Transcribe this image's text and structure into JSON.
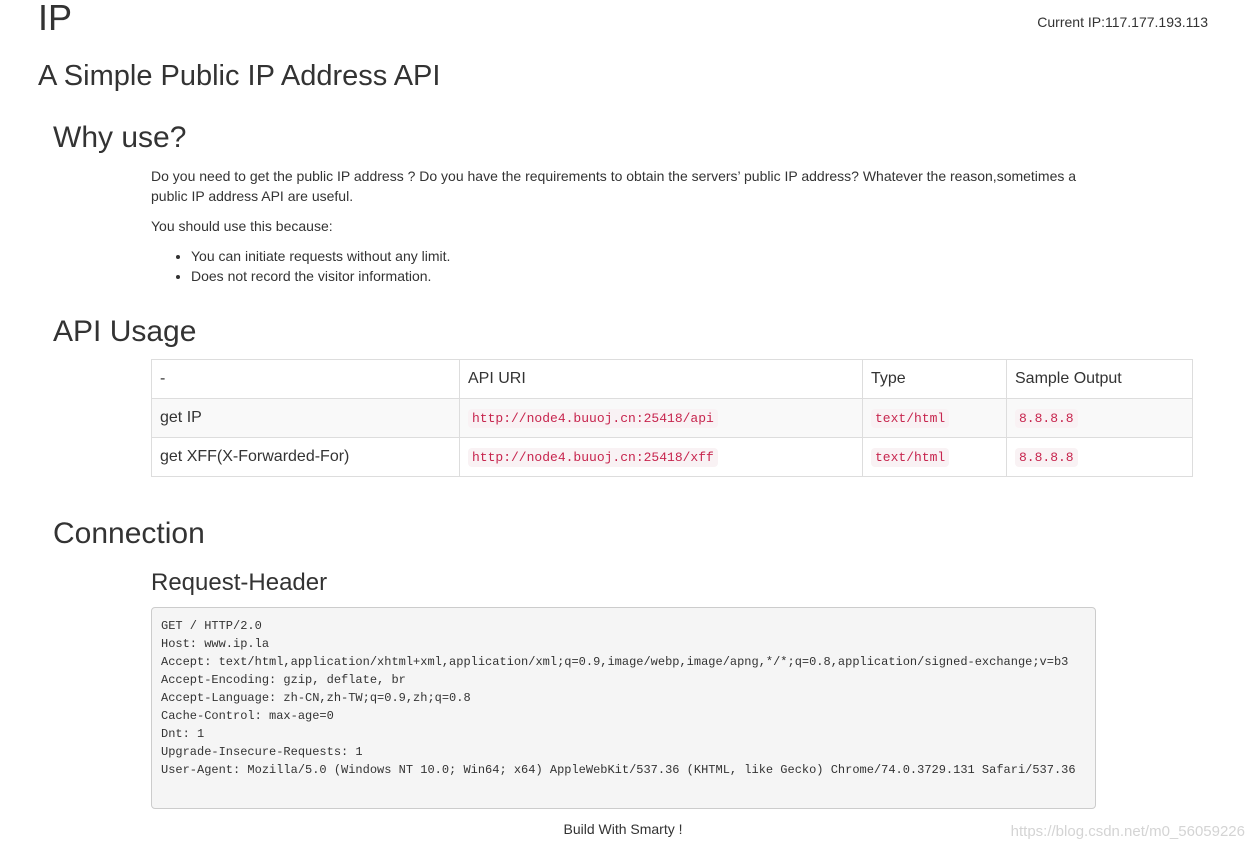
{
  "header": {
    "site_title": "IP",
    "current_ip": "Current IP:117.177.193.113",
    "subtitle": "A Simple Public IP Address API"
  },
  "why": {
    "title": "Why use?",
    "paragraph1": "Do you need to get the public IP address ? Do you have the requirements to obtain the servers’ public IP address? Whatever the reason,sometimes a public IP address API are useful.",
    "paragraph2": "You should use this because:",
    "bullets": [
      "You can initiate requests without any limit.",
      "Does not record the visitor information."
    ]
  },
  "api": {
    "title": "API Usage",
    "headers": [
      "-",
      "API URI",
      "Type",
      "Sample Output"
    ],
    "rows": [
      {
        "name": "get IP",
        "uri": "http://node4.buuoj.cn:25418/api",
        "type": "text/html",
        "output": "8.8.8.8"
      },
      {
        "name": "get XFF(X-Forwarded-For)",
        "uri": "http://node4.buuoj.cn:25418/xff",
        "type": "text/html",
        "output": "8.8.8.8"
      }
    ]
  },
  "connection": {
    "title": "Connection",
    "request_header_title": "Request-Header",
    "request_header": "GET / HTTP/2.0\nHost: www.ip.la\nAccept: text/html,application/xhtml+xml,application/xml;q=0.9,image/webp,image/apng,*/*;q=0.8,application/signed-exchange;v=b3\nAccept-Encoding: gzip, deflate, br\nAccept-Language: zh-CN,zh-TW;q=0.9,zh;q=0.8\nCache-Control: max-age=0\nDnt: 1\nUpgrade-Insecure-Requests: 1\nUser-Agent: Mozilla/5.0 (Windows NT 10.0; Win64; x64) AppleWebKit/537.36 (KHTML, like Gecko) Chrome/74.0.3729.131 Safari/537.36"
  },
  "footer": {
    "text": "Build With Smarty !",
    "watermark": "https://blog.csdn.net/m0_56059226"
  },
  "colors": {
    "code_text": "#c7254e",
    "code_bg": "#f9f2f4",
    "pre_bg": "#f5f5f5"
  }
}
